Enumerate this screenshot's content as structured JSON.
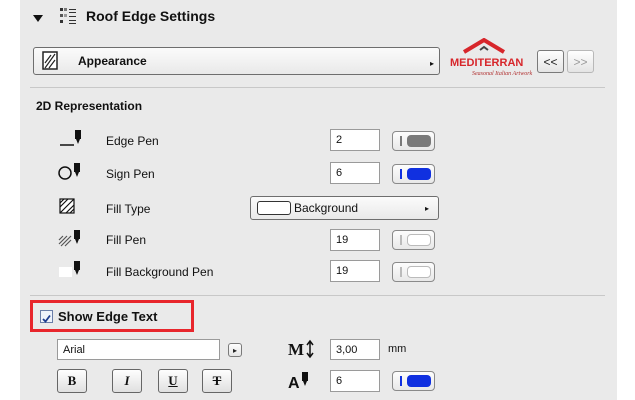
{
  "header": {
    "title": "Roof Edge Settings"
  },
  "page_select": {
    "value": "Appearance"
  },
  "logo": {
    "text": "MEDITERRAN",
    "tagline": "Seasonal Italian Artwork"
  },
  "nav": {
    "prev_label": "<<",
    "next_label": ">>"
  },
  "representation": {
    "title": "2D Representation",
    "rows": [
      {
        "label": "Edge Pen",
        "value": "2",
        "color": "#7a7a7a"
      },
      {
        "label": "Sign Pen",
        "value": "6",
        "color": "#1030e0"
      },
      {
        "label": "Fill Type",
        "value": "Background"
      },
      {
        "label": "Fill Pen",
        "value": "19",
        "color": "#ffffff"
      },
      {
        "label": "Fill Background Pen",
        "value": "19",
        "color": "#ffffff"
      }
    ]
  },
  "edge_text": {
    "checkbox_label": "Show Edge Text",
    "checked": true,
    "font": "Arial",
    "size_value": "3,00",
    "size_unit": "mm",
    "text_pen_value": "6",
    "text_pen_color": "#1030e0",
    "format_buttons": [
      "B",
      "I",
      "U",
      "T"
    ]
  },
  "colors": {
    "highlight": "#e8262c",
    "accent": "#1030e0",
    "logo_red": "#d7262b"
  }
}
